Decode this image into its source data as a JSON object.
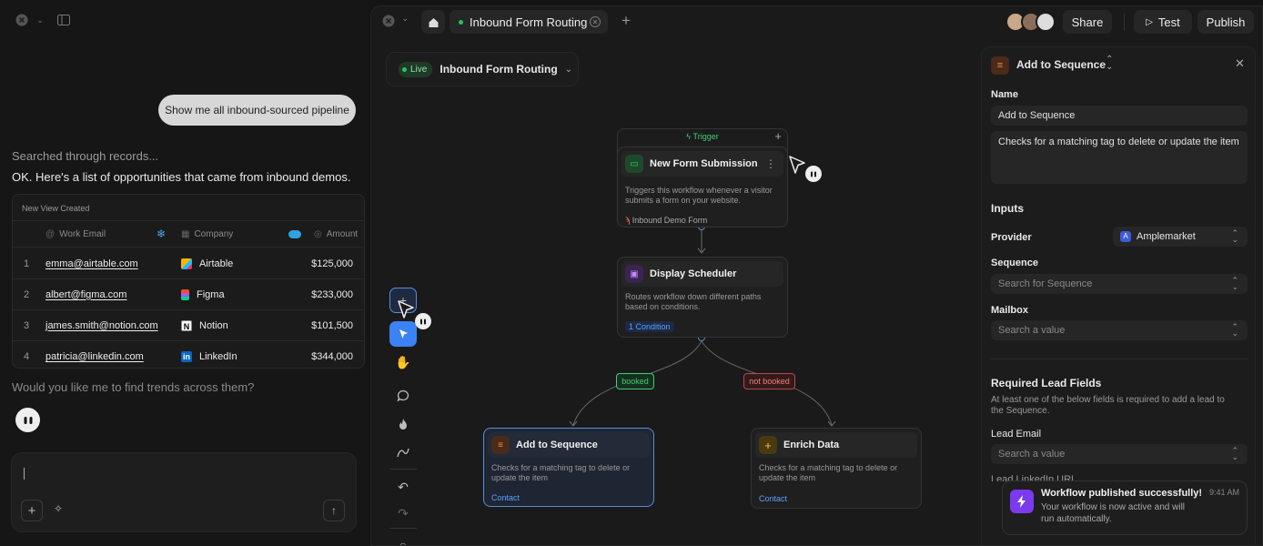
{
  "chat": {
    "prompt": "Show me all inbound-sourced pipeline",
    "searched": "Searched through records...",
    "answer": "OK. Here's a list of opportunities that came from inbound demos.",
    "table_caption": "New View Created",
    "columns": [
      "Work Email",
      "Company",
      "Amount"
    ],
    "rows": [
      {
        "n": "1",
        "email": "emma@airtable.com",
        "company": "Airtable",
        "amount": "$125,000"
      },
      {
        "n": "2",
        "email": "albert@figma.com",
        "company": "Figma",
        "amount": "$233,000"
      },
      {
        "n": "3",
        "email": "james.smith@notion.com",
        "company": "Notion",
        "amount": "$101,500"
      },
      {
        "n": "4",
        "email": "patricia@linkedin.com",
        "company": "LinkedIn",
        "amount": "$344,000"
      }
    ],
    "followup": "Would you like me to find trends across them?",
    "input_value": ""
  },
  "tabs": {
    "active_tab": "Inbound Form Routing",
    "share": "Share",
    "test": "Test",
    "publish": "Publish"
  },
  "workflow": {
    "status": "Live",
    "name": "Inbound Form Routing",
    "trigger_label": "Trigger",
    "nodes": {
      "trigger": {
        "title": "New Form Submission",
        "desc": "Triggers this workflow whenever a visitor submits a form on your website.",
        "footer": "Inbound Demo Form"
      },
      "scheduler": {
        "title": "Display Scheduler",
        "desc": "Routes workflow down different paths based on conditions.",
        "footer": "1 Condition"
      },
      "sequence": {
        "title": "Add to Sequence",
        "desc": "Checks for a matching tag to delete or update the item",
        "footer": "Contact"
      },
      "enrich": {
        "title": "Enrich Data",
        "desc": "Checks for a matching tag to delete or update the item",
        "footer": "Contact"
      }
    },
    "edges": {
      "booked": "booked",
      "not_booked": "not booked"
    }
  },
  "panel": {
    "title": "Add to Sequence",
    "name_label": "Name",
    "name_value": "Add to Sequence",
    "description": "Checks for a matching tag to delete or update the item",
    "inputs_heading": "Inputs",
    "provider_label": "Provider",
    "provider_value": "Amplemarket",
    "sequence_label": "Sequence",
    "sequence_placeholder": "Search for Sequence",
    "mailbox_label": "Mailbox",
    "mailbox_placeholder": "Search a value",
    "required_heading": "Required Lead Fields",
    "required_desc": "At least one of the below fields is required to add a lead to the Sequence.",
    "lead_email_label": "Lead Email",
    "lead_email_placeholder": "Search a value",
    "lead_linkedin_label": "Lead LinkedIn URL"
  },
  "toast": {
    "title": "Workflow published successfully!",
    "body": "Your workflow is now active and will run automatically.",
    "time": "9:41 AM"
  },
  "colors": {
    "accent_blue": "#3b82f6",
    "live_green": "#22c55e",
    "booked_green": "#3ecf70",
    "not_booked_red": "#ef5555",
    "toast_purple": "#7c3aed"
  }
}
